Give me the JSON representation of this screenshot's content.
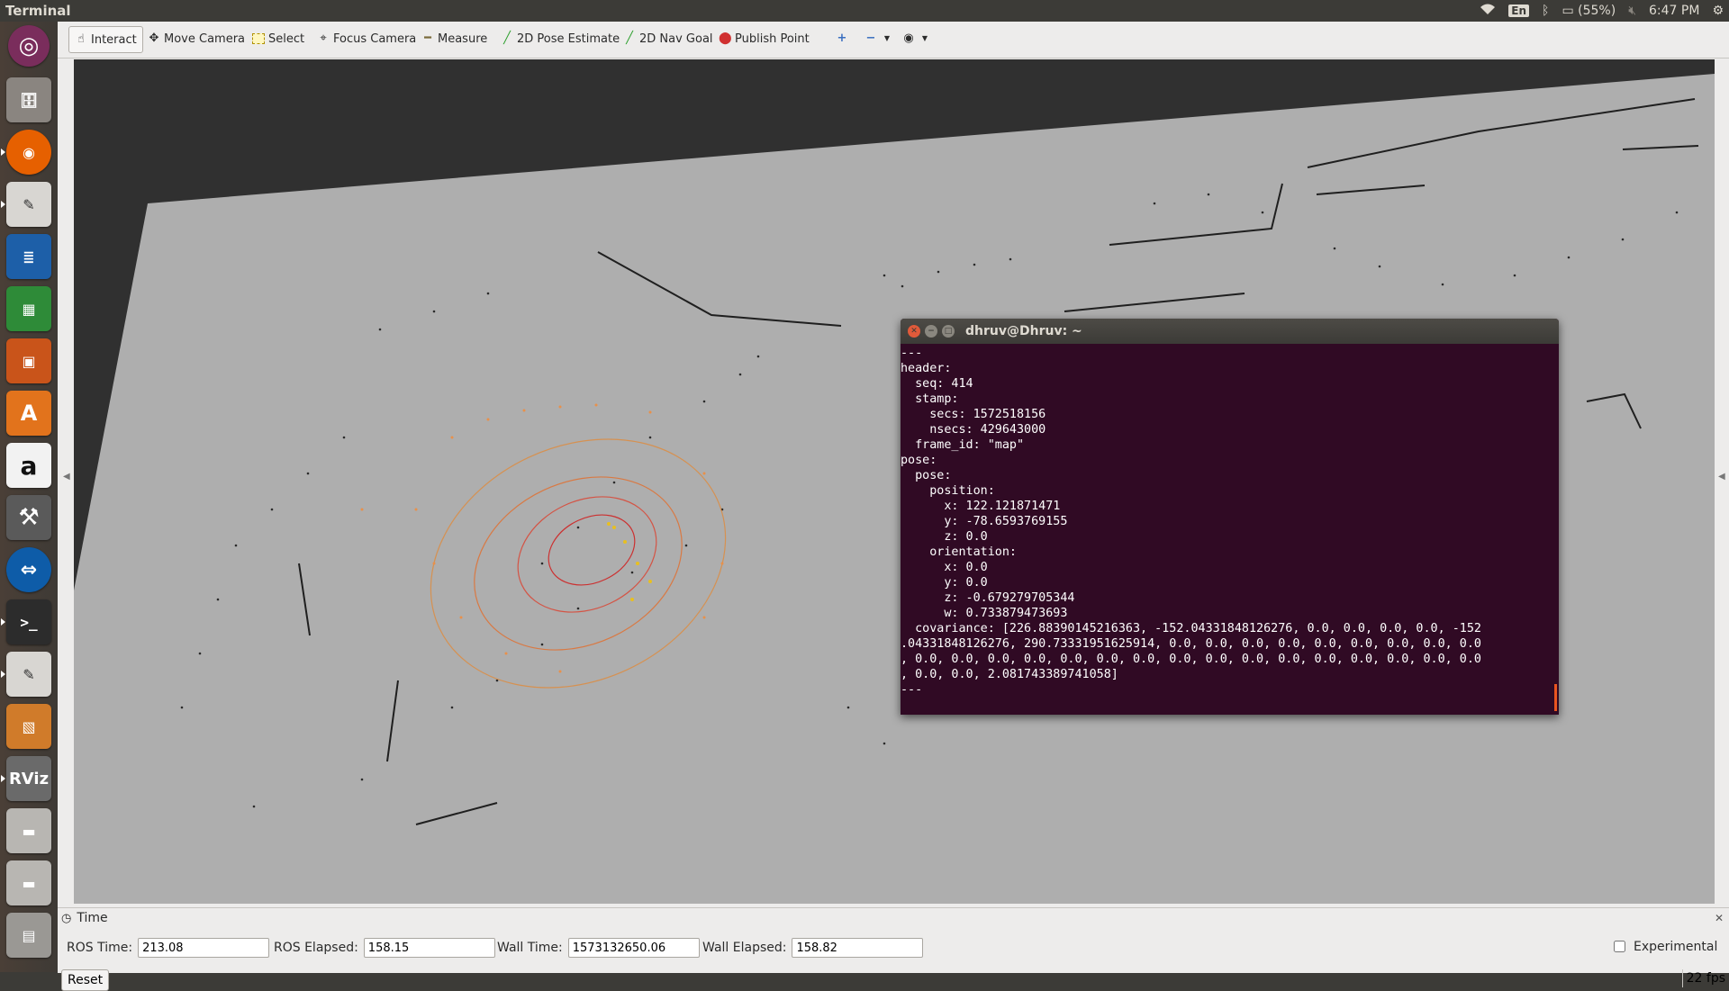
{
  "topbar": {
    "title": "Terminal",
    "lang": "En",
    "battery": "(55%)",
    "clock": "6:47 PM"
  },
  "toolbar": {
    "interact": "Interact",
    "move_camera": "Move Camera",
    "select": "Select",
    "focus_camera": "Focus Camera",
    "measure": "Measure",
    "pose_estimate": "2D Pose Estimate",
    "nav_goal": "2D Nav Goal",
    "publish_point": "Publish Point"
  },
  "launcher": {
    "apps": [
      "ubuntu-dash",
      "files",
      "firefox",
      "text-editor",
      "writer",
      "calc",
      "impress",
      "software-center",
      "amazon",
      "system-settings",
      "teamviewer",
      "terminal",
      "gedit",
      "workspaces",
      "rviz",
      "drive-1",
      "drive-2",
      "trash"
    ],
    "rviz_label": "RViz"
  },
  "terminal": {
    "title": "dhruv@Dhruv: ~",
    "lines": [
      "---",
      "header:",
      "  seq: 414",
      "  stamp:",
      "    secs: 1572518156",
      "    nsecs: 429643000",
      "  frame_id: \"map\"",
      "pose:",
      "  pose:",
      "    position:",
      "      x: 122.121871471",
      "      y: -78.6593769155",
      "      z: 0.0",
      "    orientation:",
      "      x: 0.0",
      "      y: 0.0",
      "      z: -0.679279705344",
      "      w: 0.733879473693",
      "  covariance: [226.88390145216363, -152.04331848126276, 0.0, 0.0, 0.0, 0.0, -152",
      ".04331848126276, 290.73331951625914, 0.0, 0.0, 0.0, 0.0, 0.0, 0.0, 0.0, 0.0, 0.0",
      ", 0.0, 0.0, 0.0, 0.0, 0.0, 0.0, 0.0, 0.0, 0.0, 0.0, 0.0, 0.0, 0.0, 0.0, 0.0, 0.0",
      ", 0.0, 0.0, 2.081743389741058]",
      "---"
    ]
  },
  "time_panel": {
    "title": "Time",
    "ros_time_label": "ROS Time:",
    "ros_time": "213.08",
    "ros_elapsed_label": "ROS Elapsed:",
    "ros_elapsed": "158.15",
    "wall_time_label": "Wall Time:",
    "wall_time": "1573132650.06",
    "wall_elapsed_label": "Wall Elapsed:",
    "wall_elapsed": "158.82",
    "experimental_label": "Experimental",
    "reset_label": "Reset",
    "fps": "22 fps"
  },
  "colors": {
    "terminal_bg": "#300a24",
    "map_floor": "#aeaeae",
    "viewport_bg": "#303030",
    "ubuntu_orange": "#e95420"
  }
}
